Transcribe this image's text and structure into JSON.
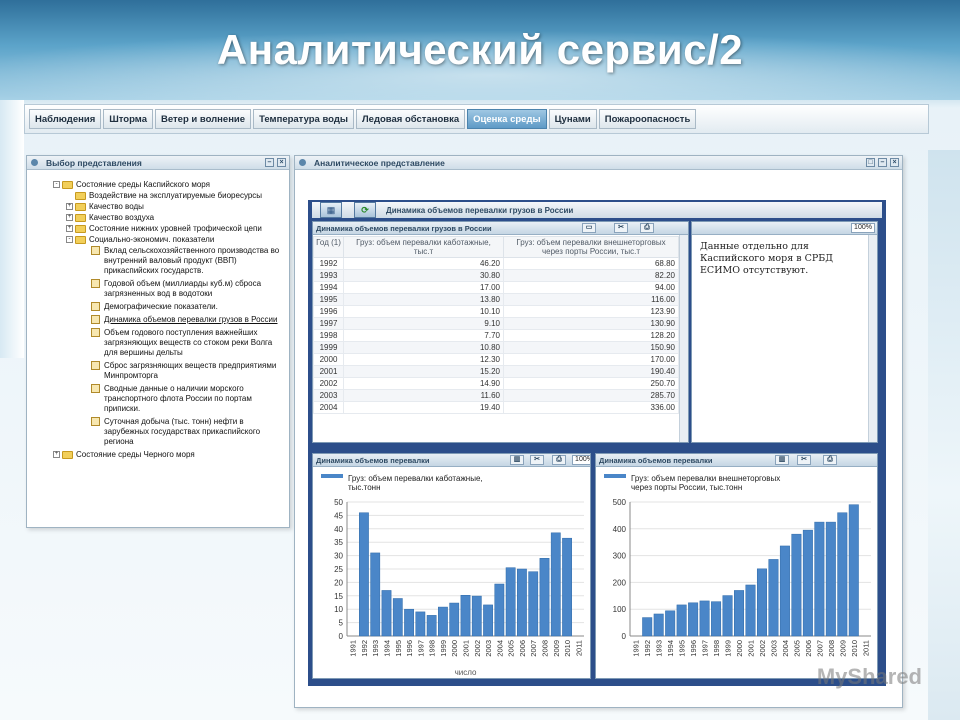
{
  "slide": {
    "title": "Аналитический сервис/2"
  },
  "tabs": [
    "Наблюдения",
    "Шторма",
    "Ветер и волнение",
    "Температура воды",
    "Ледовая обстановка",
    "Оценка среды",
    "Цунами",
    "Пожароопасность"
  ],
  "active_tab": "Оценка среды",
  "tree_panel": {
    "title": "Выбор представления",
    "nodes": [
      {
        "level": 0,
        "type": "folder",
        "exp": "-",
        "label": "Состояние среды Каспийского моря"
      },
      {
        "level": 1,
        "type": "folder",
        "exp": "",
        "label": "Воздействие на эксплуатируемые биоресурсы"
      },
      {
        "level": 1,
        "type": "folder",
        "exp": "+",
        "label": "Качество воды"
      },
      {
        "level": 1,
        "type": "folder",
        "exp": "+",
        "label": "Качество воздуха"
      },
      {
        "level": 1,
        "type": "folder",
        "exp": "+",
        "label": "Состояние нижних уровней трофической цепи"
      },
      {
        "level": 1,
        "type": "folder",
        "exp": "-",
        "label": "Социально-экономич. показатели"
      },
      {
        "level": 2,
        "type": "leaf",
        "label": "Вклад сельскохозяйственного производства во внутренний валовый продукт (ВВП) прикаспийских государств."
      },
      {
        "level": 2,
        "type": "leaf",
        "label": "Годовой объем (миллиарды куб.м) сброса загрязненных вод в водотоки"
      },
      {
        "level": 2,
        "type": "leaf",
        "label": "Демографические показатели."
      },
      {
        "level": 2,
        "type": "leaf",
        "label": "Динамика объемов перевалки грузов в России",
        "selected": true
      },
      {
        "level": 2,
        "type": "leaf",
        "label": "Объем годового поступления важнейших загрязняющих веществ со стоком реки Волга для вершины дельты"
      },
      {
        "level": 2,
        "type": "leaf",
        "label": "Сброс загрязняющих веществ предприятиями Минпромторга"
      },
      {
        "level": 2,
        "type": "leaf",
        "label": "Сводные данные о наличии морского транспортного флота России по портам приписки."
      },
      {
        "level": 2,
        "type": "leaf",
        "label": "Суточная добыча (тыс. тонн) нефти в зарубежных государствах прикаспийского региона"
      },
      {
        "level": 0,
        "type": "folder",
        "exp": "+",
        "label": "Состояние среды Черного моря"
      }
    ]
  },
  "analytic_panel": {
    "title": "Аналитическое представление",
    "inner_title": "Динамика объемов перевалки грузов в России",
    "table_title": "Динамика объемов перевалки грузов в России",
    "table_headers": [
      "Год (1)",
      "Груз: объем перевалки каботажные, тыс.т",
      "Груз: объем перевалки внешнеторговых через порты России, тыс.т"
    ],
    "table_rows": [
      [
        "1992",
        "46.20",
        "68.80"
      ],
      [
        "1993",
        "30.80",
        "82.20"
      ],
      [
        "1994",
        "17.00",
        "94.00"
      ],
      [
        "1995",
        "13.80",
        "116.00"
      ],
      [
        "1996",
        "10.10",
        "123.90"
      ],
      [
        "1997",
        "9.10",
        "130.90"
      ],
      [
        "1998",
        "7.70",
        "128.20"
      ],
      [
        "1999",
        "10.80",
        "150.90"
      ],
      [
        "2000",
        "12.30",
        "170.00"
      ],
      [
        "2001",
        "15.20",
        "190.40"
      ],
      [
        "2002",
        "14.90",
        "250.70"
      ],
      [
        "2003",
        "11.60",
        "285.70"
      ],
      [
        "2004",
        "19.40",
        "336.00"
      ]
    ],
    "note_zoom": "100%",
    "note": "Данные отдельно для Каспийского моря в СРБД ЕСИМО отсутствуют.",
    "chart_zoom": "100%"
  },
  "chart_data": [
    {
      "type": "bar",
      "title": "Динамика объемов перевалки",
      "series": [
        {
          "name": "Груз: объем перевалки каботажные, тыс.тонн",
          "values": [
            46,
            31,
            17,
            14,
            10,
            9,
            7.7,
            10.8,
            12.3,
            15.2,
            14.9,
            11.6,
            19.4,
            25.5,
            25,
            24,
            29,
            38.5,
            36.5
          ]
        }
      ],
      "categories": [
        "1991",
        "1992",
        "1993",
        "1994",
        "1995",
        "1996",
        "1997",
        "1998",
        "1999",
        "2000",
        "2001",
        "2002",
        "2003",
        "2004",
        "2005",
        "2006",
        "2007",
        "2008",
        "2009",
        "2010",
        "2011"
      ],
      "bar_categories": [
        "1992",
        "1993",
        "1994",
        "1995",
        "1996",
        "1997",
        "1998",
        "1999",
        "2000",
        "2001",
        "2002",
        "2003",
        "2004",
        "2005",
        "2006",
        "2007",
        "2008",
        "2009",
        "2010"
      ],
      "ylim": [
        0,
        50
      ],
      "yticks": [
        0,
        5,
        10,
        15,
        20,
        25,
        30,
        35,
        40,
        45,
        50
      ],
      "xlabel": "число",
      "color": "#4a86c8"
    },
    {
      "type": "bar",
      "title": "Динамика объемов перевалки",
      "series": [
        {
          "name": "Груз: объем перевалки внешнеторговых через порты России, тыс.тонн",
          "values": [
            68.8,
            82.2,
            94,
            116,
            123.9,
            130.9,
            128.2,
            150.9,
            170,
            190.4,
            250.7,
            285.7,
            336,
            380,
            395,
            425,
            425,
            460,
            490
          ]
        }
      ],
      "categories": [
        "1991",
        "1992",
        "1993",
        "1994",
        "1995",
        "1996",
        "1997",
        "1998",
        "1999",
        "2000",
        "2001",
        "2002",
        "2003",
        "2004",
        "2005",
        "2006",
        "2007",
        "2008",
        "2009",
        "2010",
        "2011"
      ],
      "bar_categories": [
        "1992",
        "1993",
        "1994",
        "1995",
        "1996",
        "1997",
        "1998",
        "1999",
        "2000",
        "2001",
        "2002",
        "2003",
        "2004",
        "2005",
        "2006",
        "2007",
        "2008",
        "2009",
        "2010"
      ],
      "ylim": [
        0,
        500
      ],
      "yticks": [
        0,
        100,
        200,
        300,
        400,
        500
      ],
      "xlabel": "",
      "color": "#4a86c8"
    }
  ],
  "watermark": "MyShared"
}
